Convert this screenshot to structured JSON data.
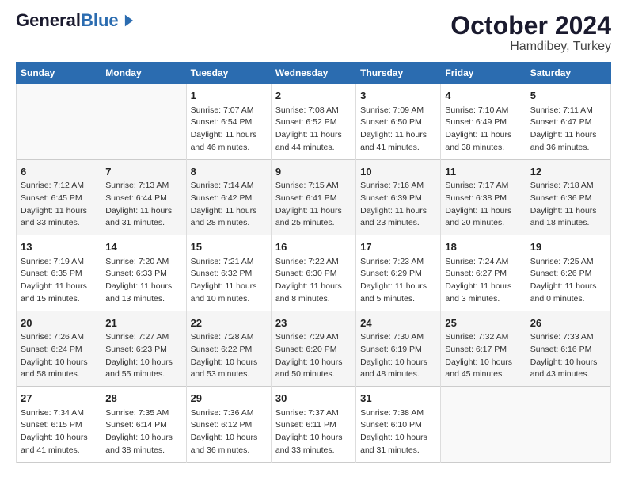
{
  "header": {
    "logo_general": "General",
    "logo_blue": "Blue",
    "month": "October 2024",
    "location": "Hamdibey, Turkey"
  },
  "days_of_week": [
    "Sunday",
    "Monday",
    "Tuesday",
    "Wednesday",
    "Thursday",
    "Friday",
    "Saturday"
  ],
  "weeks": [
    [
      {
        "day": "",
        "sunrise": "",
        "sunset": "",
        "daylight": ""
      },
      {
        "day": "",
        "sunrise": "",
        "sunset": "",
        "daylight": ""
      },
      {
        "day": "1",
        "sunrise": "Sunrise: 7:07 AM",
        "sunset": "Sunset: 6:54 PM",
        "daylight": "Daylight: 11 hours and 46 minutes."
      },
      {
        "day": "2",
        "sunrise": "Sunrise: 7:08 AM",
        "sunset": "Sunset: 6:52 PM",
        "daylight": "Daylight: 11 hours and 44 minutes."
      },
      {
        "day": "3",
        "sunrise": "Sunrise: 7:09 AM",
        "sunset": "Sunset: 6:50 PM",
        "daylight": "Daylight: 11 hours and 41 minutes."
      },
      {
        "day": "4",
        "sunrise": "Sunrise: 7:10 AM",
        "sunset": "Sunset: 6:49 PM",
        "daylight": "Daylight: 11 hours and 38 minutes."
      },
      {
        "day": "5",
        "sunrise": "Sunrise: 7:11 AM",
        "sunset": "Sunset: 6:47 PM",
        "daylight": "Daylight: 11 hours and 36 minutes."
      }
    ],
    [
      {
        "day": "6",
        "sunrise": "Sunrise: 7:12 AM",
        "sunset": "Sunset: 6:45 PM",
        "daylight": "Daylight: 11 hours and 33 minutes."
      },
      {
        "day": "7",
        "sunrise": "Sunrise: 7:13 AM",
        "sunset": "Sunset: 6:44 PM",
        "daylight": "Daylight: 11 hours and 31 minutes."
      },
      {
        "day": "8",
        "sunrise": "Sunrise: 7:14 AM",
        "sunset": "Sunset: 6:42 PM",
        "daylight": "Daylight: 11 hours and 28 minutes."
      },
      {
        "day": "9",
        "sunrise": "Sunrise: 7:15 AM",
        "sunset": "Sunset: 6:41 PM",
        "daylight": "Daylight: 11 hours and 25 minutes."
      },
      {
        "day": "10",
        "sunrise": "Sunrise: 7:16 AM",
        "sunset": "Sunset: 6:39 PM",
        "daylight": "Daylight: 11 hours and 23 minutes."
      },
      {
        "day": "11",
        "sunrise": "Sunrise: 7:17 AM",
        "sunset": "Sunset: 6:38 PM",
        "daylight": "Daylight: 11 hours and 20 minutes."
      },
      {
        "day": "12",
        "sunrise": "Sunrise: 7:18 AM",
        "sunset": "Sunset: 6:36 PM",
        "daylight": "Daylight: 11 hours and 18 minutes."
      }
    ],
    [
      {
        "day": "13",
        "sunrise": "Sunrise: 7:19 AM",
        "sunset": "Sunset: 6:35 PM",
        "daylight": "Daylight: 11 hours and 15 minutes."
      },
      {
        "day": "14",
        "sunrise": "Sunrise: 7:20 AM",
        "sunset": "Sunset: 6:33 PM",
        "daylight": "Daylight: 11 hours and 13 minutes."
      },
      {
        "day": "15",
        "sunrise": "Sunrise: 7:21 AM",
        "sunset": "Sunset: 6:32 PM",
        "daylight": "Daylight: 11 hours and 10 minutes."
      },
      {
        "day": "16",
        "sunrise": "Sunrise: 7:22 AM",
        "sunset": "Sunset: 6:30 PM",
        "daylight": "Daylight: 11 hours and 8 minutes."
      },
      {
        "day": "17",
        "sunrise": "Sunrise: 7:23 AM",
        "sunset": "Sunset: 6:29 PM",
        "daylight": "Daylight: 11 hours and 5 minutes."
      },
      {
        "day": "18",
        "sunrise": "Sunrise: 7:24 AM",
        "sunset": "Sunset: 6:27 PM",
        "daylight": "Daylight: 11 hours and 3 minutes."
      },
      {
        "day": "19",
        "sunrise": "Sunrise: 7:25 AM",
        "sunset": "Sunset: 6:26 PM",
        "daylight": "Daylight: 11 hours and 0 minutes."
      }
    ],
    [
      {
        "day": "20",
        "sunrise": "Sunrise: 7:26 AM",
        "sunset": "Sunset: 6:24 PM",
        "daylight": "Daylight: 10 hours and 58 minutes."
      },
      {
        "day": "21",
        "sunrise": "Sunrise: 7:27 AM",
        "sunset": "Sunset: 6:23 PM",
        "daylight": "Daylight: 10 hours and 55 minutes."
      },
      {
        "day": "22",
        "sunrise": "Sunrise: 7:28 AM",
        "sunset": "Sunset: 6:22 PM",
        "daylight": "Daylight: 10 hours and 53 minutes."
      },
      {
        "day": "23",
        "sunrise": "Sunrise: 7:29 AM",
        "sunset": "Sunset: 6:20 PM",
        "daylight": "Daylight: 10 hours and 50 minutes."
      },
      {
        "day": "24",
        "sunrise": "Sunrise: 7:30 AM",
        "sunset": "Sunset: 6:19 PM",
        "daylight": "Daylight: 10 hours and 48 minutes."
      },
      {
        "day": "25",
        "sunrise": "Sunrise: 7:32 AM",
        "sunset": "Sunset: 6:17 PM",
        "daylight": "Daylight: 10 hours and 45 minutes."
      },
      {
        "day": "26",
        "sunrise": "Sunrise: 7:33 AM",
        "sunset": "Sunset: 6:16 PM",
        "daylight": "Daylight: 10 hours and 43 minutes."
      }
    ],
    [
      {
        "day": "27",
        "sunrise": "Sunrise: 7:34 AM",
        "sunset": "Sunset: 6:15 PM",
        "daylight": "Daylight: 10 hours and 41 minutes."
      },
      {
        "day": "28",
        "sunrise": "Sunrise: 7:35 AM",
        "sunset": "Sunset: 6:14 PM",
        "daylight": "Daylight: 10 hours and 38 minutes."
      },
      {
        "day": "29",
        "sunrise": "Sunrise: 7:36 AM",
        "sunset": "Sunset: 6:12 PM",
        "daylight": "Daylight: 10 hours and 36 minutes."
      },
      {
        "day": "30",
        "sunrise": "Sunrise: 7:37 AM",
        "sunset": "Sunset: 6:11 PM",
        "daylight": "Daylight: 10 hours and 33 minutes."
      },
      {
        "day": "31",
        "sunrise": "Sunrise: 7:38 AM",
        "sunset": "Sunset: 6:10 PM",
        "daylight": "Daylight: 10 hours and 31 minutes."
      },
      {
        "day": "",
        "sunrise": "",
        "sunset": "",
        "daylight": ""
      },
      {
        "day": "",
        "sunrise": "",
        "sunset": "",
        "daylight": ""
      }
    ]
  ]
}
